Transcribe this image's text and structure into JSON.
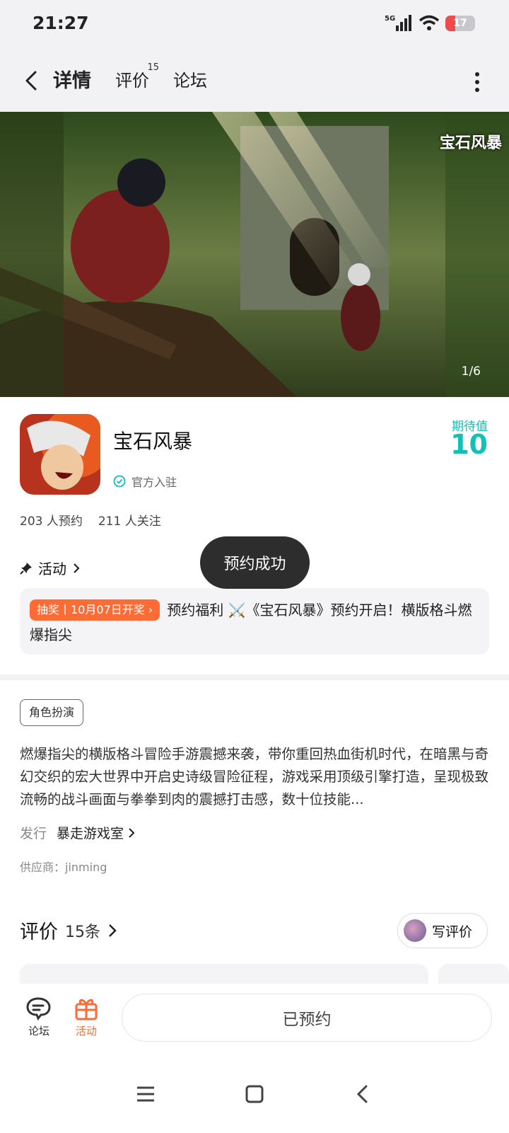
{
  "status_bar": {
    "time": "21:27",
    "network": "5G",
    "battery": "17"
  },
  "nav": {
    "tabs": [
      {
        "label": "详情",
        "active": true
      },
      {
        "label": "评价",
        "badge": "15"
      },
      {
        "label": "论坛"
      }
    ]
  },
  "banner": {
    "logo_text": "宝石风暴",
    "counter": "1/6"
  },
  "app": {
    "name": "宝石风暴",
    "official_label": "官方入驻",
    "expect_label": "期待值",
    "expect_value": "10",
    "reservations": "203 人预约",
    "followers": "211 人关注"
  },
  "activity": {
    "heading": "活动",
    "tag": "抽奖丨10月07日开奖",
    "text": "预约福利 ⚔️《宝石风暴》预约开启！横版格斗燃爆指尖"
  },
  "toast": "预约成功",
  "details": {
    "genre_tag": "角色扮演",
    "description": "燃爆指尖的横版格斗冒险手游震撼来袭，带你重回热血街机时代，在暗黑与奇幻交织的宏大世界中开启史诗级冒险征程，游戏采用顶级引擎打造，呈现极致流畅的战斗画面与拳拳到肉的震撼打击感，数十位技能...",
    "publisher_key": "发行",
    "publisher_value": "暴走游戏室",
    "supplier": "供应商：jinming"
  },
  "reviews": {
    "title": "评价",
    "count": "15条",
    "write_label": "写评价"
  },
  "bottom_bar": {
    "forum_label": "论坛",
    "activity_label": "活动",
    "reserved_label": "已预约"
  },
  "colors": {
    "accent": "#13c0b5",
    "orange": "#ff6b35"
  }
}
